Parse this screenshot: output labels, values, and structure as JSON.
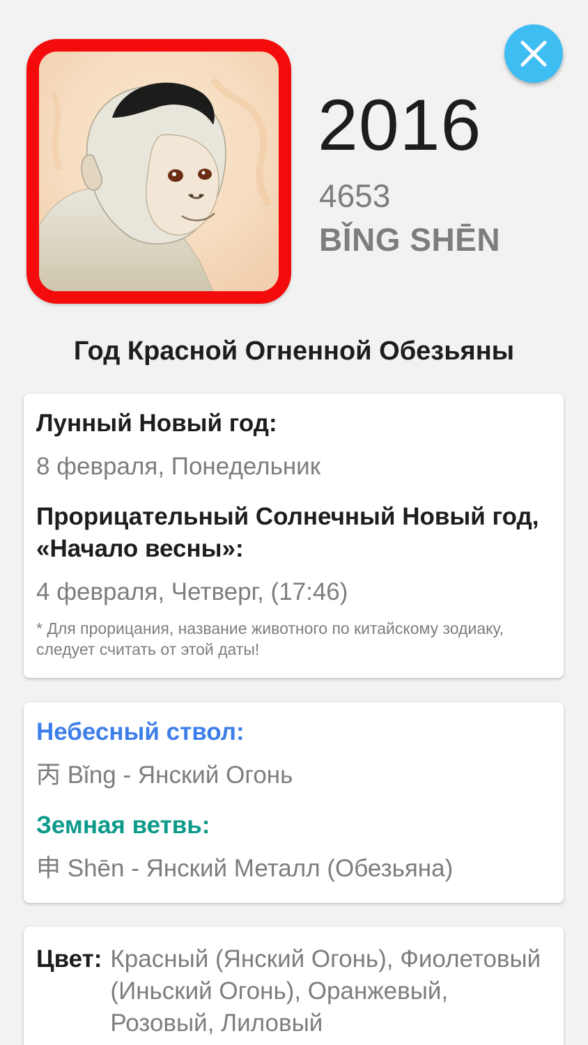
{
  "header": {
    "close_icon": "close-icon",
    "animal_image": "monkey-portrait",
    "year": "2016",
    "chinese_year_number": "4653",
    "year_name": "BǏNG SHĒN"
  },
  "title": "Год Красной Огненной Обезьяны",
  "dates_card": {
    "lunar_label": "Лунный Новый год:",
    "lunar_value": "8 февраля, Понедельник",
    "solar_label": "Прорицательный Солнечный Новый год, «Начало весны»:",
    "solar_value": "4 февраля, Четверг, (17:46)",
    "note": "* Для прорицания, название животного по китайскому зодиаку, следует считать от этой даты!"
  },
  "stems_card": {
    "stem_label": "Небесный ствол:",
    "stem_value": "丙 Bǐng - Янский Огонь",
    "branch_label": "Земная ветвь:",
    "branch_value": "申 Shēn - Янский Металл (Обезьяна)"
  },
  "color_card": {
    "label": "Цвет:",
    "value": "Красный (Янский Огонь), Фиолетовый (Иньский Огонь), Оранжевый, Розовый, Лиловый"
  },
  "colors": {
    "accent_blue": "#3d7ee8",
    "accent_teal": "#0d9a8a",
    "frame_red": "#f40c0c",
    "close_button": "#3dbdf2"
  }
}
